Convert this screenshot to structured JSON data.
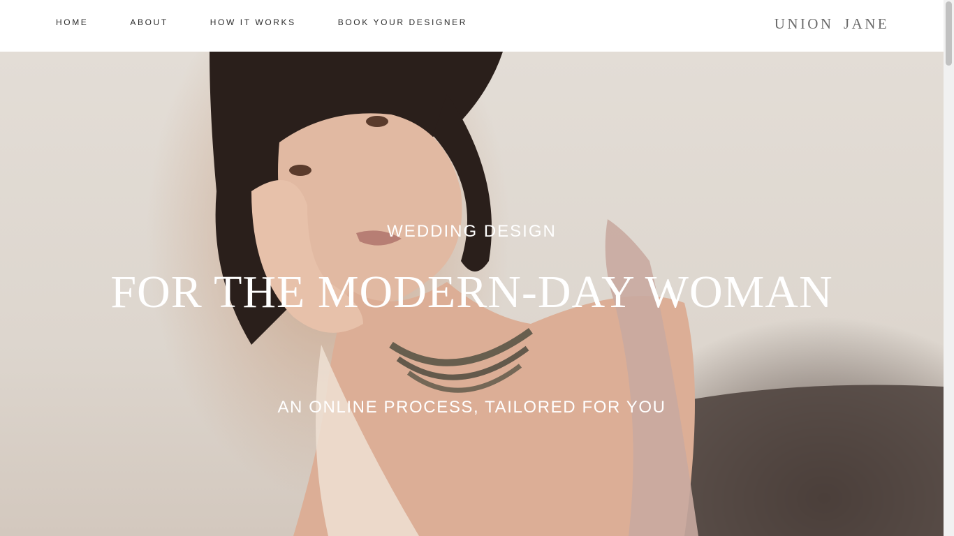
{
  "nav": {
    "items": [
      {
        "label": "HOME"
      },
      {
        "label": "ABOUT"
      },
      {
        "label": "HOW IT WORKS"
      },
      {
        "label": "BOOK YOUR DESIGNER"
      }
    ]
  },
  "brand": {
    "logo_text": "UNION JANE"
  },
  "hero": {
    "eyebrow": "WEDDING DESIGN",
    "headline": "FOR THE MODERN-DAY WOMAN",
    "tagline": "AN ONLINE PROCESS, TAILORED FOR YOU",
    "image_subject": "woman-portrait"
  },
  "colors": {
    "nav_text": "#2b2b2b",
    "logo_text": "#6b6b6b",
    "hero_text": "#ffffff",
    "header_bg": "#ffffff"
  }
}
